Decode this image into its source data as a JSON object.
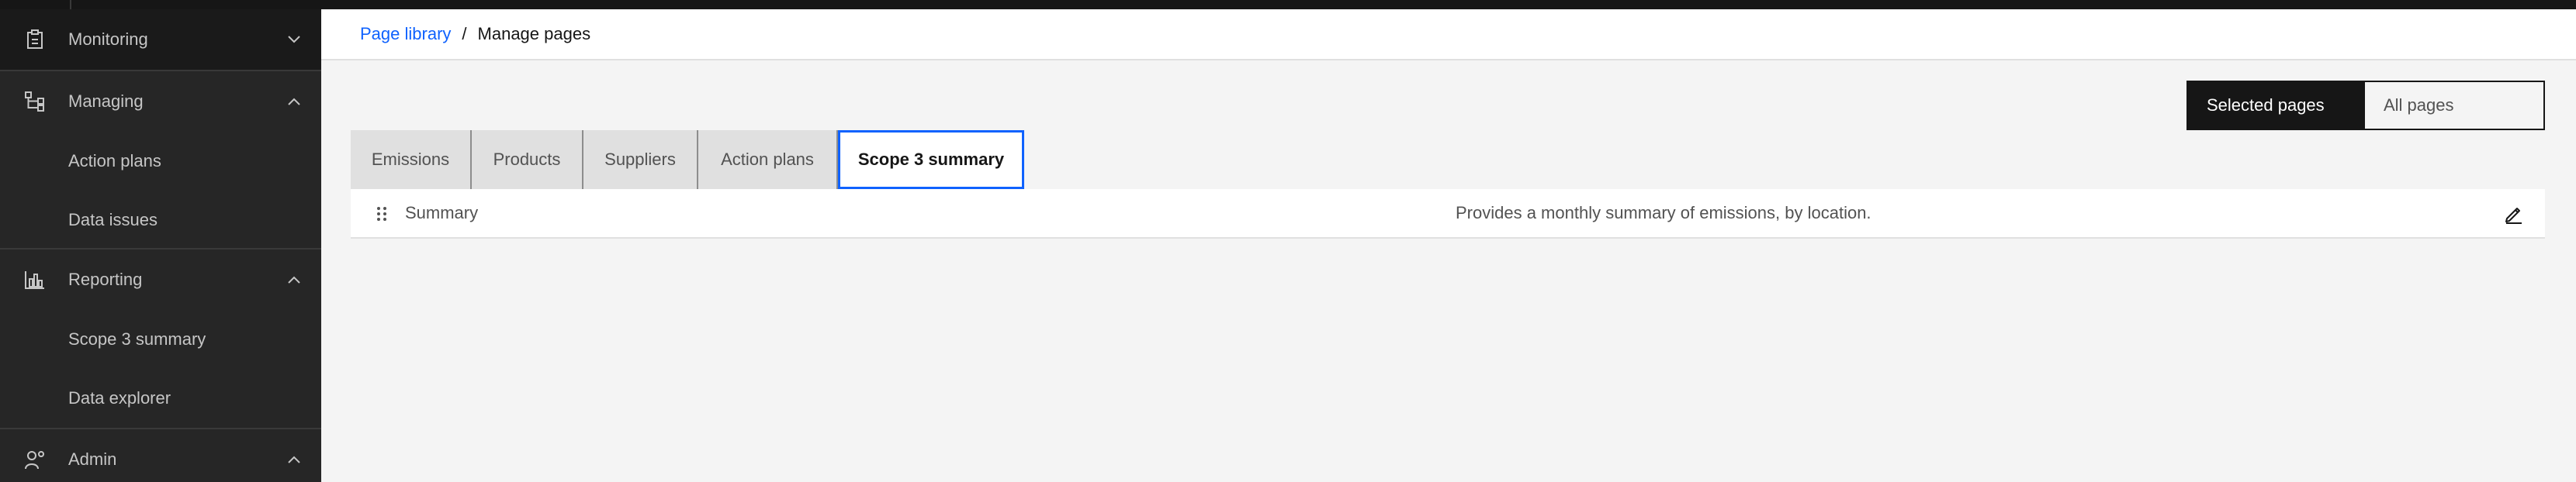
{
  "sidebar": {
    "groups": [
      {
        "label": "Monitoring",
        "icon": "clipboard-icon",
        "expanded": false
      },
      {
        "label": "Managing",
        "icon": "tree-view-icon",
        "expanded": true,
        "items": [
          "Action plans",
          "Data issues"
        ]
      },
      {
        "label": "Reporting",
        "icon": "bar-chart-icon",
        "expanded": true,
        "items": [
          "Scope 3 summary",
          "Data explorer"
        ]
      },
      {
        "label": "Admin",
        "icon": "user-admin-icon",
        "expanded": true
      }
    ]
  },
  "breadcrumb": {
    "link": "Page library",
    "separator": "/",
    "current": "Manage pages"
  },
  "switcher": {
    "selected": "Selected pages",
    "other": "All pages"
  },
  "tabs": [
    "Emissions",
    "Products",
    "Suppliers",
    "Action plans",
    "Scope 3 summary"
  ],
  "selected_tab": "Scope 3 summary",
  "rows": [
    {
      "name": "Summary",
      "description": "Provides a monthly summary of emissions, by location."
    }
  ],
  "colors": {
    "accent": "#0f62fe",
    "sidebar_bg": "#262626",
    "page_bg": "#f4f4f4"
  }
}
